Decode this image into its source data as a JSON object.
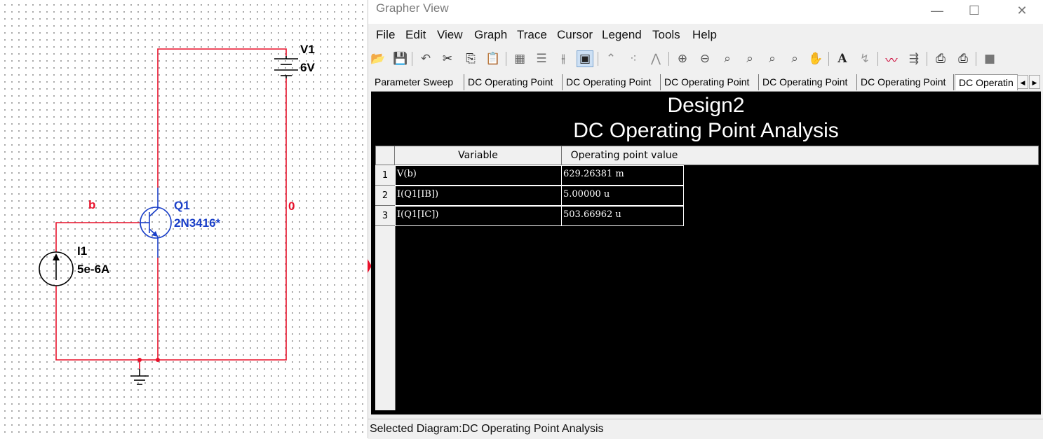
{
  "schematic": {
    "battery": {
      "name": "V1",
      "value": "6V"
    },
    "transistor": {
      "name": "Q1",
      "model": "2N3416*"
    },
    "current_source": {
      "name": "I1",
      "value": "5e-6A"
    },
    "nets": {
      "base": "b",
      "collector": "0"
    },
    "colors": {
      "wire": "#e8102a",
      "component": "#1a3fc8",
      "label": "#000000"
    }
  },
  "grapher": {
    "title": "Grapher View",
    "window_buttons": {
      "minimize": "—",
      "maximize": "☐",
      "close": "✕"
    },
    "menu": [
      "File",
      "Edit",
      "View",
      "Graph",
      "Trace",
      "Cursor",
      "Legend",
      "Tools",
      "Help"
    ],
    "toolbar_icons": [
      "open-icon",
      "save-icon",
      "undo-icon",
      "cut-icon",
      "copy-icon",
      "paste-icon",
      "grid-icon",
      "legend-icon",
      "cursor-icon",
      "overlay-icon",
      "line-icon",
      "scatter-icon",
      "line-points-icon",
      "zoom-in-icon",
      "zoom-out-icon",
      "zoom-fit-icon",
      "zoom-x-icon",
      "zoom-y-icon",
      "zoom-area-icon",
      "pan-icon",
      "text-icon",
      "label-icon",
      "trace-icon",
      "export-icon",
      "print-icon",
      "print-preview-icon",
      "stop-icon"
    ],
    "tabs": [
      "Parameter Sweep",
      "DC Operating Point",
      "DC Operating Point",
      "DC Operating Point",
      "DC Operating Point",
      "DC Operating Point",
      "DC Operatin"
    ],
    "active_tab_index": 6,
    "diagram": {
      "title": "Design2",
      "subtitle": "DC Operating Point Analysis",
      "columns": [
        "Variable",
        "Operating point value"
      ],
      "rows": [
        {
          "num": "1",
          "variable": "V(b)",
          "value": "629.26381 m"
        },
        {
          "num": "2",
          "variable": "I(Q1[IB])",
          "value": "5.00000 u"
        },
        {
          "num": "3",
          "variable": "I(Q1[IC])",
          "value": "503.66962 u"
        }
      ]
    },
    "status": "Selected Diagram:DC Operating Point Analysis"
  }
}
